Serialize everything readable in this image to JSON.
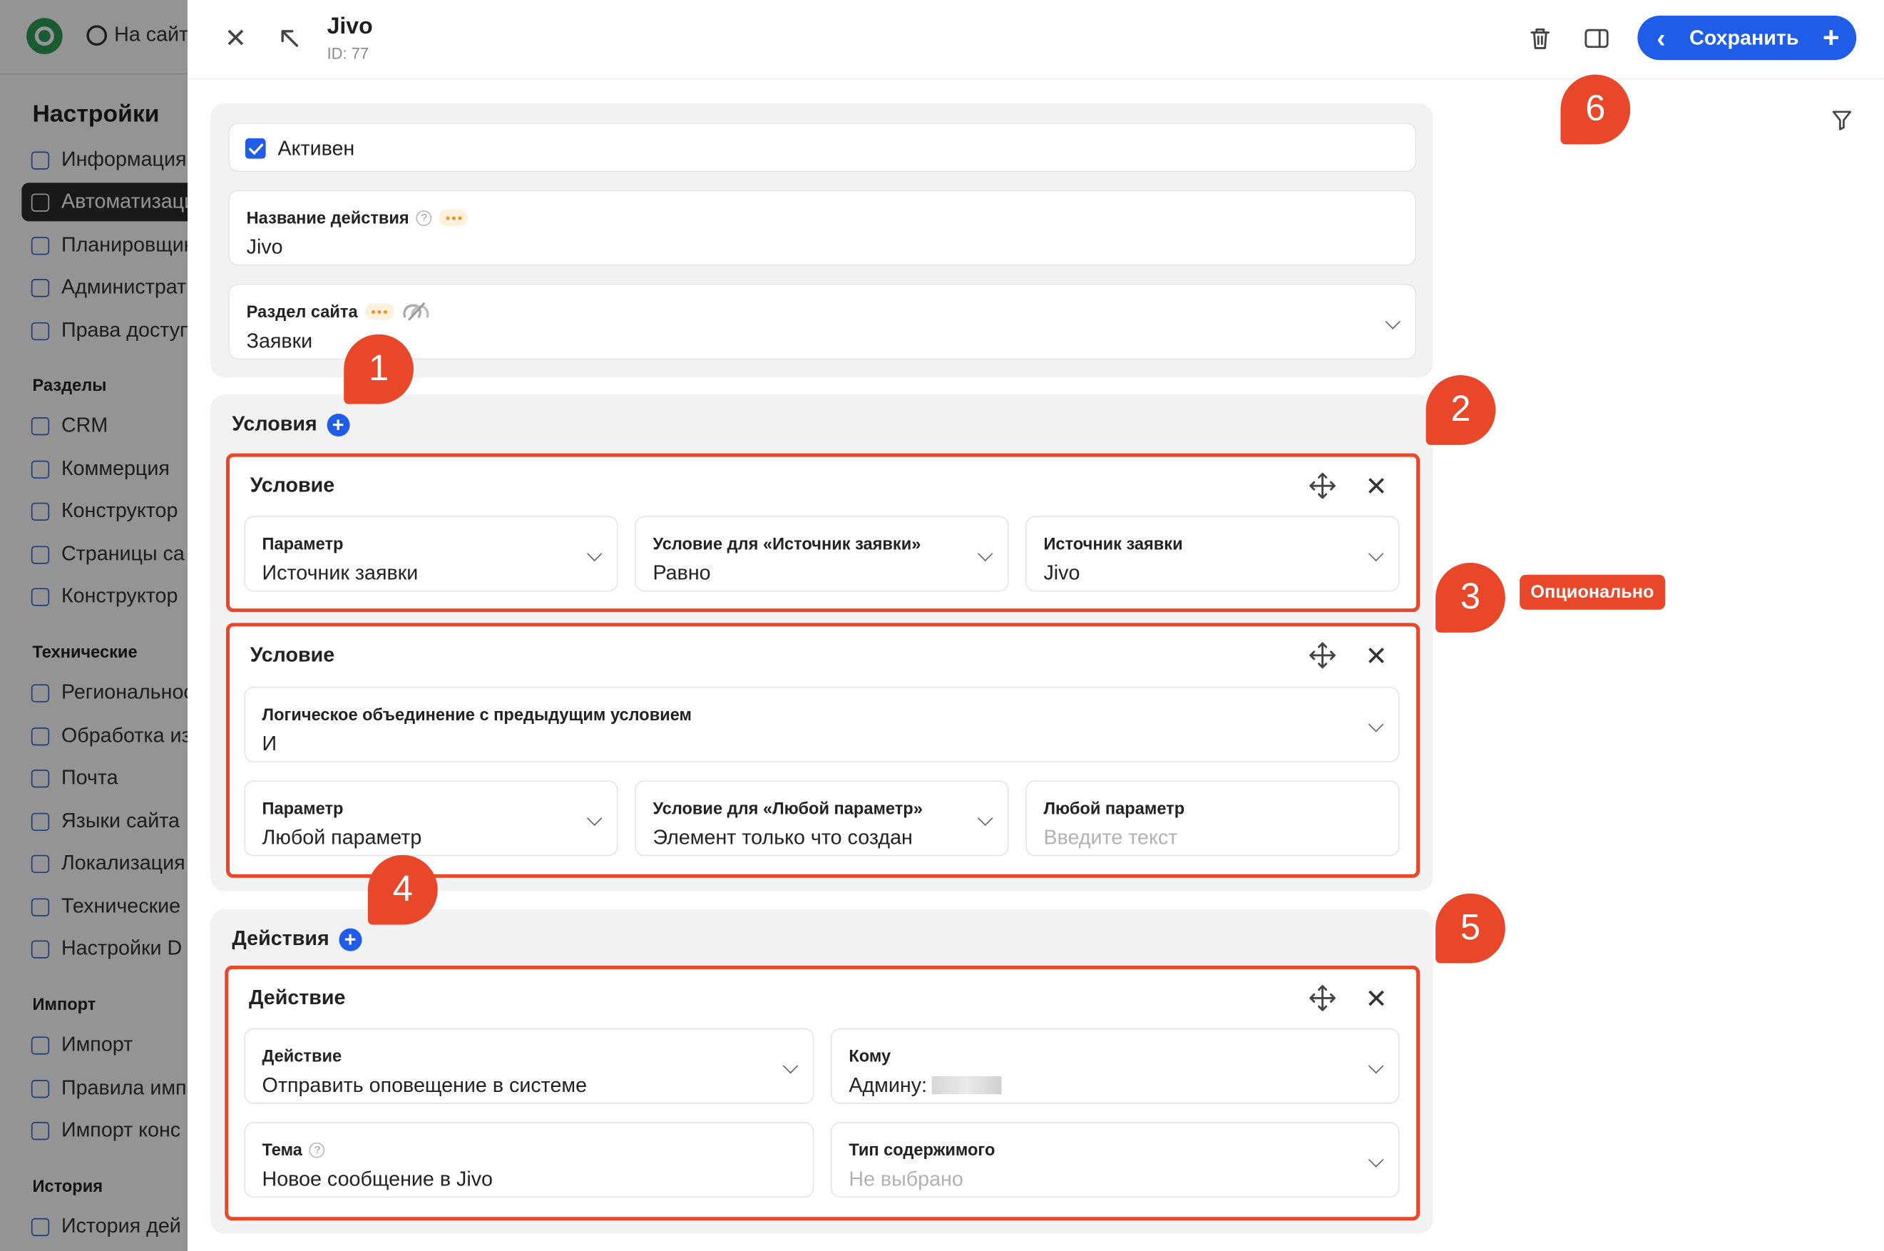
{
  "backdrop": {
    "site_link": "На сайт",
    "title": "Настройки",
    "sections": [
      {
        "title": "",
        "items": [
          "Информация",
          "Автоматизация",
          "Планировщик",
          "Администрат",
          "Права доступ"
        ]
      },
      {
        "title": "Разделы",
        "items": [
          "CRM",
          "Коммерция",
          "Конструктор",
          "Страницы са",
          "Конструктор"
        ]
      },
      {
        "title": "Технические",
        "items": [
          "Региональнос",
          "Обработка из",
          "Почта",
          "Языки сайта",
          "Локализация",
          "Технические",
          "Настройки D"
        ]
      },
      {
        "title": "Импорт",
        "items": [
          "Импорт",
          "Правила имп",
          "Импорт конс"
        ]
      },
      {
        "title": "История",
        "items": [
          "История дей"
        ]
      }
    ],
    "active_item": "Автоматизация"
  },
  "panel": {
    "title": "Jivo",
    "id_text": "ID: 77",
    "save_label": "Сохранить",
    "icons": [
      "close-icon",
      "collapse-arrow-icon",
      "trash-icon",
      "sidebar-toggle-icon",
      "filter-icon"
    ]
  },
  "general": {
    "active_label": "Активен",
    "active_checked": true,
    "name_label": "Название действия",
    "name_value": "Jivo",
    "section_label": "Раздел сайта",
    "section_value": "Заявки"
  },
  "conditions": {
    "title": "Условия",
    "items": [
      {
        "title": "Условие",
        "fields": [
          {
            "label": "Параметр",
            "value": "Источник заявки"
          },
          {
            "label": "Условие для «Источник заявки»",
            "value": "Равно"
          },
          {
            "label": "Источник заявки",
            "value": "Jivo"
          }
        ]
      },
      {
        "title": "Условие",
        "logic_label": "Логическое объединение с предыдущим условием",
        "logic_value": "И",
        "fields": [
          {
            "label": "Параметр",
            "value": "Любой параметр"
          },
          {
            "label": "Условие для «Любой параметр»",
            "value": "Элемент только что создан"
          },
          {
            "label": "Любой параметр",
            "value": "",
            "placeholder": "Введите текст"
          }
        ]
      }
    ]
  },
  "actions": {
    "title": "Действия",
    "items": [
      {
        "title": "Действие",
        "action_label": "Действие",
        "action_value": "Отправить оповещение в системе",
        "to_label": "Кому",
        "to_value": "Админу:",
        "topic_label": "Тема",
        "topic_value": "Новое сообщение в Jivo",
        "content_label": "Тип содержимого",
        "content_value": "Не выбрано"
      }
    ]
  },
  "annotations": {
    "markers": [
      "1",
      "2",
      "3",
      "4",
      "5",
      "6"
    ],
    "optional_tag": "Опционально",
    "accent_color": "#e8472a"
  },
  "colors": {
    "primary": "#1f5de8",
    "annotation": "#e8472a",
    "card_bg": "#f2f2f2"
  }
}
